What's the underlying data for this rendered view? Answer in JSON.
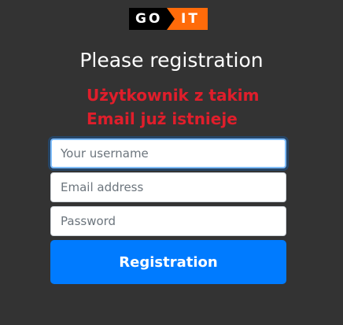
{
  "logo": {
    "left_text": "GO",
    "right_text": "IT",
    "left_color": "#000000",
    "right_color": "#ff6b0a"
  },
  "form": {
    "title": "Please registration",
    "error_line_1": "Użytkownik z takim",
    "error_line_2": "Email już istnieje",
    "username_placeholder": "Your username",
    "email_placeholder": "Email address",
    "password_placeholder": "Password",
    "submit_label": "Registration"
  },
  "colors": {
    "background": "#333333",
    "error": "#e01e2b",
    "accent": "#007bff"
  }
}
